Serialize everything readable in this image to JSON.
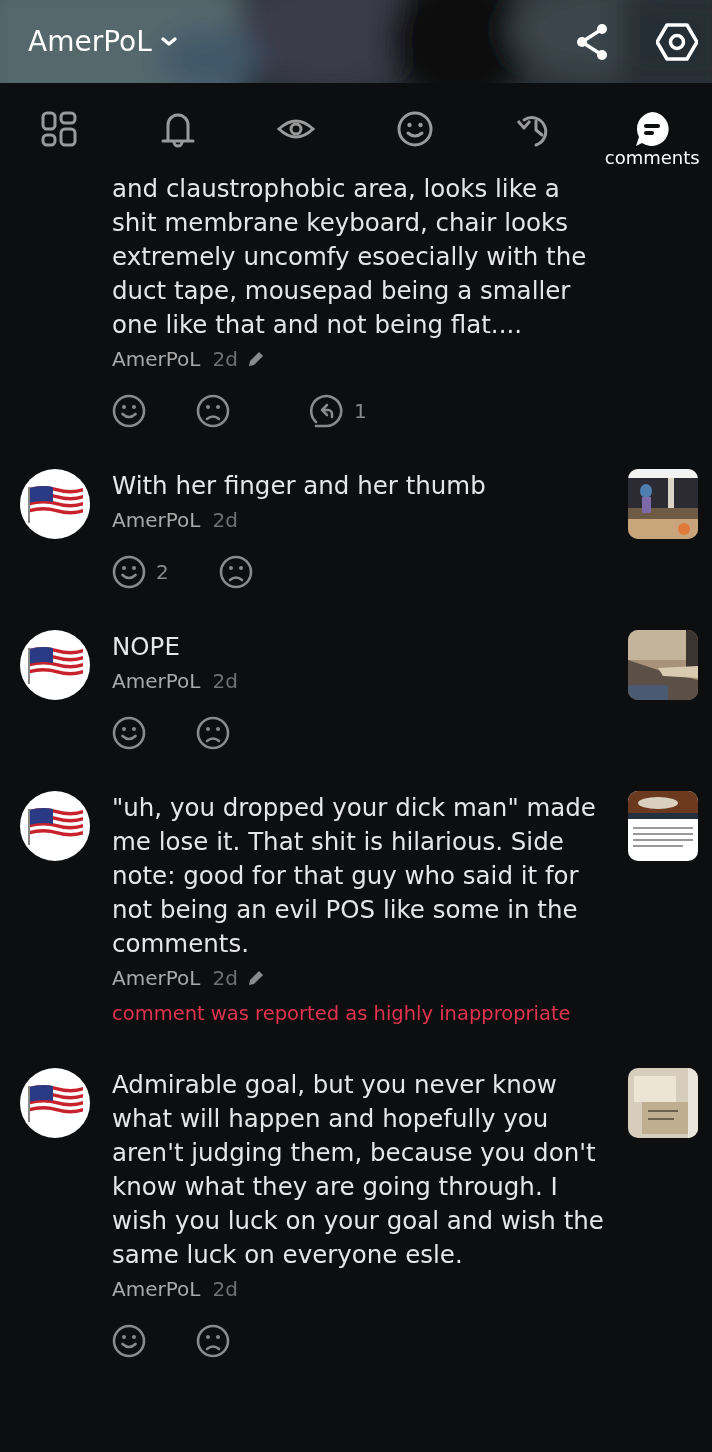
{
  "header": {
    "title": "AmerPoL"
  },
  "tabs": [
    {
      "kind": "grid",
      "selected": false
    },
    {
      "kind": "bell",
      "selected": false
    },
    {
      "kind": "eye",
      "selected": false
    },
    {
      "kind": "smile",
      "selected": false
    },
    {
      "kind": "history",
      "selected": false
    },
    {
      "kind": "comments",
      "label": "comments",
      "selected": true
    }
  ],
  "comments": [
    {
      "avatar": false,
      "thumbnail": false,
      "text": "and claustrophobic area, looks like a shit membrane keyboard, chair looks extremely uncomfy esoecially with the duct tape, mousepad being a smaller one like that and not being flat....",
      "author": "AmerPoL",
      "time": "2d",
      "edited": true,
      "reactions": [
        {
          "kind": "like"
        },
        {
          "kind": "dislike"
        },
        {
          "kind": "reply",
          "count": "1"
        }
      ]
    },
    {
      "avatar": true,
      "thumbnail": true,
      "text": "With her finger and her thumb",
      "author": "AmerPoL",
      "time": "2d",
      "edited": false,
      "reactions": [
        {
          "kind": "like",
          "count": "2"
        },
        {
          "kind": "dislike"
        }
      ]
    },
    {
      "avatar": true,
      "thumbnail": true,
      "text": "NOPE",
      "author": "AmerPoL",
      "time": "2d",
      "edited": false,
      "reactions": [
        {
          "kind": "like"
        },
        {
          "kind": "dislike"
        }
      ]
    },
    {
      "avatar": true,
      "thumbnail": true,
      "text": "\"uh, you dropped your dick man\" made me lose it. That shit is hilarious. Side note: good for that guy who said it for not being an evil POS like some in the comments.",
      "author": "AmerPoL",
      "time": "2d",
      "edited": true,
      "notice": "comment was reported as highly inappropriate"
    },
    {
      "avatar": true,
      "thumbnail": true,
      "text": "Admirable goal, but you never know what will happen and hopefully you aren't judging them, because you don't know what they are going through. I wish you luck on your goal and wish the same luck on everyone esle.",
      "author": "AmerPoL",
      "time": "2d",
      "edited": false,
      "reactions": [
        {
          "kind": "like"
        },
        {
          "kind": "dislike"
        }
      ]
    }
  ]
}
